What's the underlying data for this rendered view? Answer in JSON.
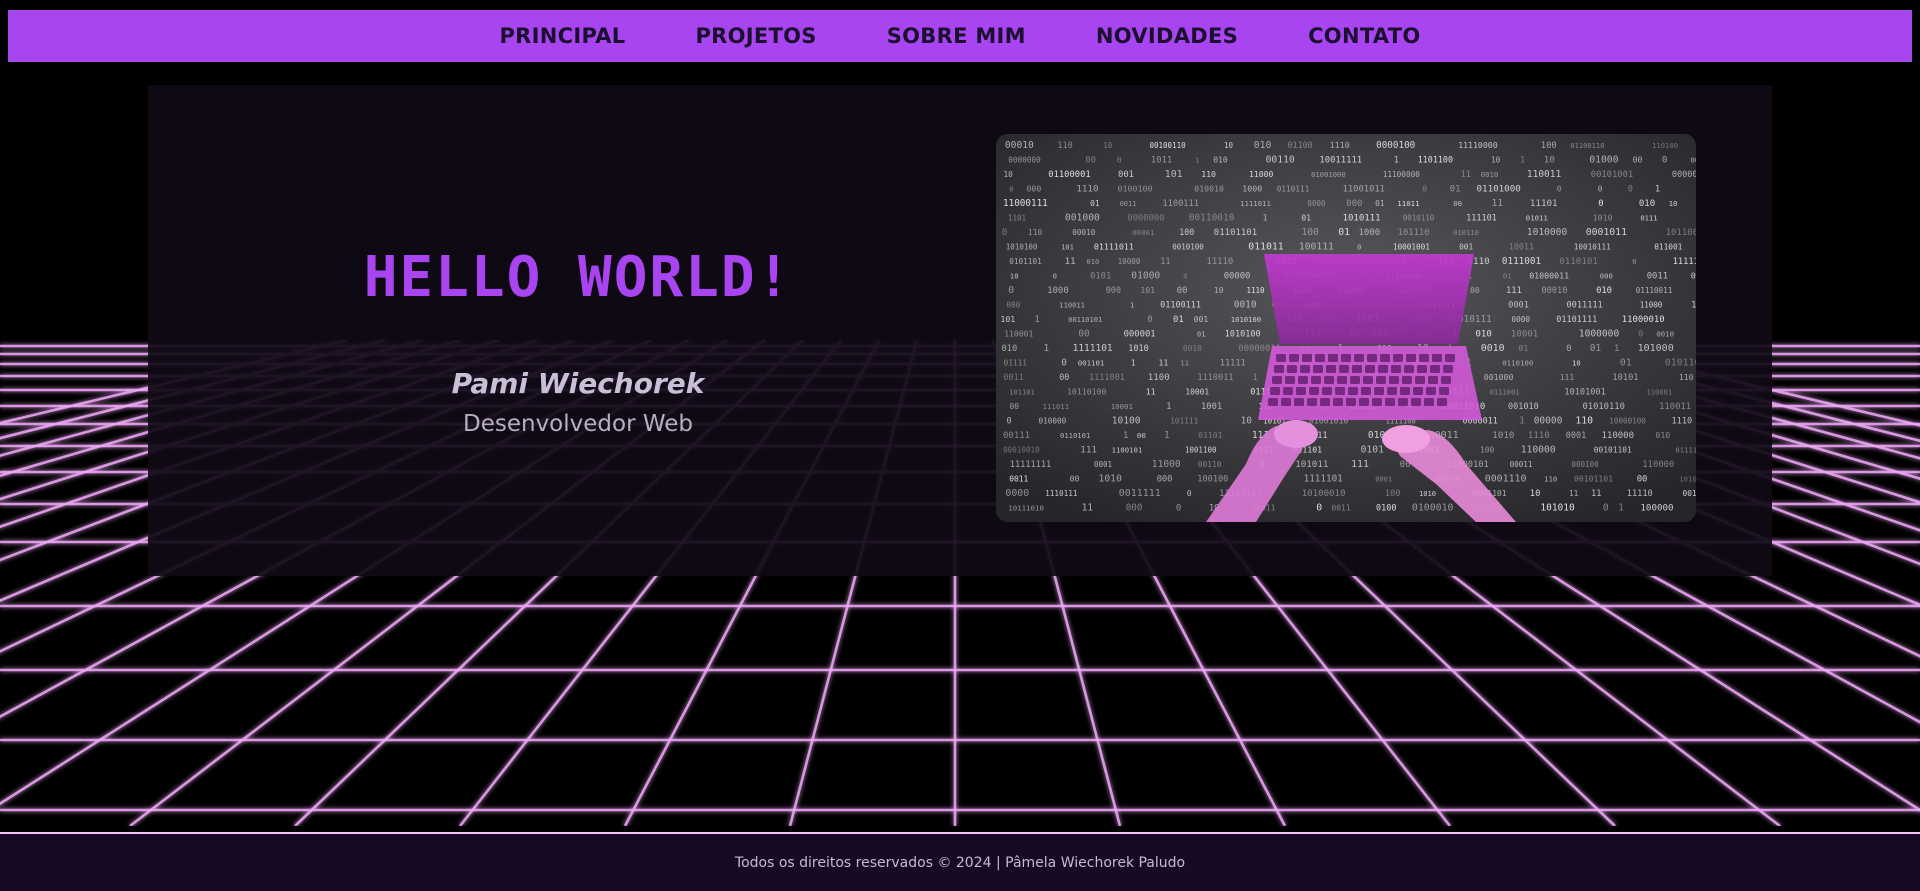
{
  "nav": {
    "items": [
      {
        "label": "PRINCIPAL"
      },
      {
        "label": "PROJETOS"
      },
      {
        "label": "SOBRE MIM"
      },
      {
        "label": "NOVIDADES"
      },
      {
        "label": "CONTATO"
      }
    ]
  },
  "hero": {
    "title": "HELLO WORLD!",
    "name": "Pami Wiechorek",
    "role": "Desenvolvedor Web",
    "image": "laptop-coding-binary-image"
  },
  "footer": {
    "text": "Todos os direitos reservados © 2024 | Pâmela Wiechorek Paludo"
  },
  "colors": {
    "accent": "#a845f0",
    "grid": "#f0a8f8",
    "background": "#000000",
    "card": "#100a16",
    "footer": "#180a24"
  }
}
